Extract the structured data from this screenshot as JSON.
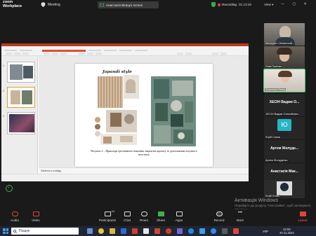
{
  "app": {
    "brand_line1": "zoom",
    "brand_line2": "Workplace",
    "meeting_label": "Meeting",
    "share_label": "Анастасія Вігвщ's screen",
    "recording_label": "Recording",
    "timer": "01:13:26",
    "view_label": "View"
  },
  "slide": {
    "title": "Japandi style",
    "caption": "Рисунок 2 – Приклади ергономічні показник закриттів проекту за допоміжним штучного інтелекту"
  },
  "notes_placeholder": "Заметки к слайду",
  "participants": [
    {
      "name": "Mezhybev Chelamonik",
      "style": "photo"
    },
    {
      "name": "Лиза Гасенко",
      "style": "photo"
    },
    {
      "name": "Анастасія Вігвщ",
      "style": "photo",
      "active": true
    },
    {
      "big": "ХЕСІН Вадим О...",
      "name": "ХЕСІН Вадим Олексійович",
      "style": "name"
    },
    {
      "avatar": "Ю",
      "name": "Юрій Санна",
      "style": "avatar"
    },
    {
      "big": "Артем Жолуде...",
      "name": "Артем Жолудєнко",
      "style": "name"
    },
    {
      "big": "Анастасія Мак...",
      "name": "Анастасія Максимів...",
      "style": "name"
    },
    {
      "name": "Emilli Emiliv",
      "style": "photo"
    }
  ],
  "toolbar": {
    "audio": "Audio",
    "video": "Video",
    "participants": "Participants",
    "participants_count": "44",
    "chat": "Chat",
    "react": "React",
    "share": "Share",
    "apps": "Apps",
    "record": "Record",
    "more": "More",
    "leave": "Leave"
  },
  "watermark": {
    "title": "Активація Windows",
    "line": "Перейдіть до розділу \"Настройки\", щоб активувати Windows."
  },
  "taskbar": {
    "search_placeholder": "Пошук",
    "lang": "УКР",
    "time": "12:09",
    "date": "20.11.2024"
  },
  "colors": {
    "zoom_green": "#3fb24f",
    "leave_red": "#e0463a",
    "ppt_orange": "#b83b1e"
  }
}
